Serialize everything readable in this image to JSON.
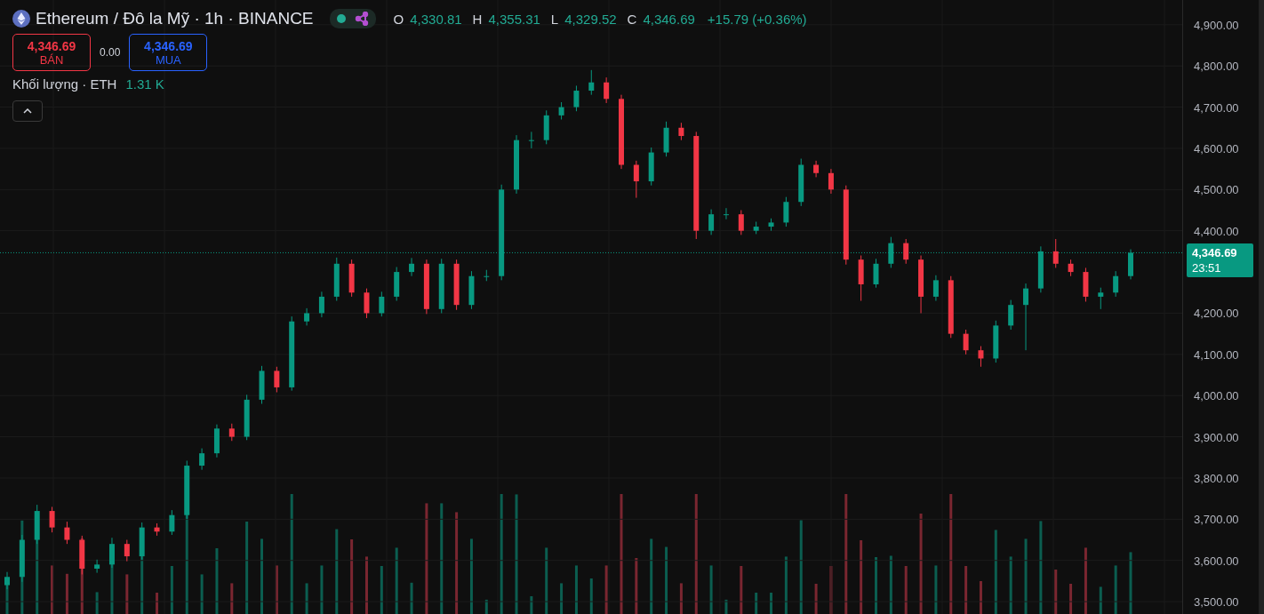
{
  "header": {
    "symbol": "Ethereum / Đô la Mỹ · 1h · BINANCE",
    "market_open": true,
    "ohlc": [
      {
        "label": "O",
        "value": "4,330.81"
      },
      {
        "label": "H",
        "value": "4,355.31"
      },
      {
        "label": "L",
        "value": "4,329.52"
      },
      {
        "label": "C",
        "value": "4,346.69"
      }
    ],
    "change": "+15.79 (+0.36%)"
  },
  "trade": {
    "sell": {
      "price": "4,346.69",
      "label": "BÁN"
    },
    "spread": "0.00",
    "buy": {
      "price": "4,346.69",
      "label": "MUA"
    }
  },
  "volume_legend": {
    "label": "Khối lượng · ETH",
    "value": "1.31 K"
  },
  "last_price": {
    "countdown": "23:51"
  },
  "chart_data": {
    "type": "candlestick",
    "ylim": [
      3470,
      4960
    ],
    "grid": true,
    "ref_lines": [
      {
        "axis": "y",
        "value": 4346.69,
        "label": "4,346.69",
        "color": "#089981"
      }
    ],
    "yticks": [
      {
        "value": 4900,
        "label": "4,900.00"
      },
      {
        "value": 4800,
        "label": "4,800.00"
      },
      {
        "value": 4700,
        "label": "4,700.00"
      },
      {
        "value": 4600,
        "label": "4,600.00"
      },
      {
        "value": 4500,
        "label": "4,500.00"
      },
      {
        "value": 4400,
        "label": "4,400.00"
      },
      {
        "value": 4200,
        "label": "4,200.00"
      },
      {
        "value": 4100,
        "label": "4,100.00"
      },
      {
        "value": 4000,
        "label": "4,000.00"
      },
      {
        "value": 3900,
        "label": "3,900.00"
      },
      {
        "value": 3800,
        "label": "3,800.00"
      },
      {
        "value": 3700,
        "label": "3,700.00"
      },
      {
        "value": 3600,
        "label": "3,600.00"
      },
      {
        "value": 3500,
        "label": "3,500.00"
      }
    ],
    "ohlc": [
      [
        3540,
        3572,
        3530,
        3560
      ],
      [
        3560,
        3662,
        3548,
        3650
      ],
      [
        3650,
        3735,
        3640,
        3720
      ],
      [
        3720,
        3730,
        3668,
        3680
      ],
      [
        3680,
        3694,
        3640,
        3650
      ],
      [
        3650,
        3660,
        3566,
        3580
      ],
      [
        3580,
        3602,
        3570,
        3590
      ],
      [
        3590,
        3655,
        3582,
        3640
      ],
      [
        3640,
        3650,
        3598,
        3610
      ],
      [
        3610,
        3692,
        3602,
        3680
      ],
      [
        3680,
        3690,
        3660,
        3670
      ],
      [
        3670,
        3722,
        3662,
        3710
      ],
      [
        3710,
        3842,
        3700,
        3830
      ],
      [
        3830,
        3872,
        3820,
        3860
      ],
      [
        3860,
        3930,
        3850,
        3920
      ],
      [
        3920,
        3932,
        3890,
        3900
      ],
      [
        3900,
        4002,
        3892,
        3990
      ],
      [
        3990,
        4072,
        3980,
        4060
      ],
      [
        4060,
        4070,
        4008,
        4020
      ],
      [
        4020,
        4192,
        4012,
        4180
      ],
      [
        4180,
        4212,
        4170,
        4200
      ],
      [
        4200,
        4252,
        4190,
        4240
      ],
      [
        4240,
        4335,
        4230,
        4320
      ],
      [
        4320,
        4330,
        4240,
        4250
      ],
      [
        4250,
        4260,
        4188,
        4200
      ],
      [
        4200,
        4252,
        4192,
        4240
      ],
      [
        4240,
        4312,
        4230,
        4300
      ],
      [
        4300,
        4334,
        4290,
        4320
      ],
      [
        4320,
        4330,
        4198,
        4210
      ],
      [
        4210,
        4332,
        4200,
        4320
      ],
      [
        4320,
        4330,
        4208,
        4220
      ],
      [
        4220,
        4302,
        4210,
        4290
      ],
      [
        4290,
        4305,
        4278,
        4290
      ],
      [
        4290,
        4512,
        4280,
        4500
      ],
      [
        4500,
        4632,
        4490,
        4620
      ],
      [
        4620,
        4640,
        4600,
        4620
      ],
      [
        4620,
        4692,
        4610,
        4680
      ],
      [
        4680,
        4712,
        4670,
        4700
      ],
      [
        4700,
        4752,
        4690,
        4740
      ],
      [
        4740,
        4790,
        4730,
        4760
      ],
      [
        4760,
        4772,
        4710,
        4720
      ],
      [
        4720,
        4730,
        4550,
        4560
      ],
      [
        4560,
        4570,
        4480,
        4520
      ],
      [
        4520,
        4602,
        4510,
        4590
      ],
      [
        4590,
        4665,
        4580,
        4650
      ],
      [
        4650,
        4662,
        4620,
        4630
      ],
      [
        4630,
        4640,
        4380,
        4400
      ],
      [
        4400,
        4452,
        4390,
        4440
      ],
      [
        4440,
        4455,
        4428,
        4440
      ],
      [
        4440,
        4450,
        4390,
        4400
      ],
      [
        4400,
        4422,
        4392,
        4410
      ],
      [
        4410,
        4430,
        4400,
        4420
      ],
      [
        4420,
        4482,
        4410,
        4470
      ],
      [
        4470,
        4575,
        4460,
        4560
      ],
      [
        4560,
        4570,
        4530,
        4540
      ],
      [
        4540,
        4550,
        4490,
        4500
      ],
      [
        4500,
        4510,
        4318,
        4330
      ],
      [
        4330,
        4340,
        4230,
        4270
      ],
      [
        4270,
        4332,
        4262,
        4320
      ],
      [
        4320,
        4385,
        4310,
        4370
      ],
      [
        4370,
        4380,
        4320,
        4330
      ],
      [
        4330,
        4340,
        4200,
        4240
      ],
      [
        4240,
        4292,
        4230,
        4280
      ],
      [
        4280,
        4290,
        4140,
        4150
      ],
      [
        4150,
        4160,
        4100,
        4110
      ],
      [
        4110,
        4120,
        4070,
        4090
      ],
      [
        4090,
        4182,
        4080,
        4170
      ],
      [
        4170,
        4232,
        4160,
        4220
      ],
      [
        4220,
        4272,
        4110,
        4260
      ],
      [
        4260,
        4362,
        4250,
        4350
      ],
      [
        4350,
        4380,
        4310,
        4320
      ],
      [
        4320,
        4330,
        4290,
        4300
      ],
      [
        4300,
        4310,
        4228,
        4240
      ],
      [
        4240,
        4262,
        4210,
        4250
      ],
      [
        4250,
        4302,
        4240,
        4290
      ],
      [
        4290,
        4355,
        4282,
        4346.69
      ]
    ]
  }
}
